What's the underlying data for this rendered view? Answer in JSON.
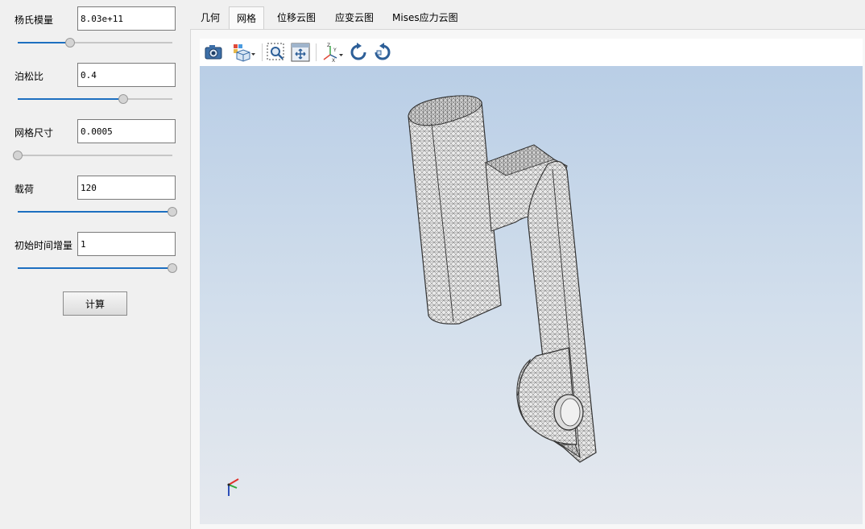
{
  "params": [
    {
      "label": "杨氏模量",
      "value": "8.03e+11",
      "slider": 0.34
    },
    {
      "label": "泊松比",
      "value": "0.4",
      "slider": 0.68
    },
    {
      "label": "网格尺寸",
      "value": "0.0005",
      "slider": 0.0
    },
    {
      "label": "载荷",
      "value": "120",
      "slider": 1.0
    },
    {
      "label": "初始时间增量",
      "value": "1",
      "slider": 1.0
    }
  ],
  "calc_button": "计算",
  "tabs": [
    "几何",
    "网格",
    "位移云图",
    "应变云图",
    "Mises应力云图"
  ],
  "active_tab": "网格",
  "toolbar_icons": [
    "camera-icon",
    "view-cube-icon",
    "zoom-box-icon",
    "fit-all-icon",
    "axes-triad-icon",
    "rotate-cw-icon",
    "rotate-ccw-icon"
  ],
  "colors": {
    "accent": "#1d6fc0",
    "viewport_top": "#b9cee6",
    "viewport_bottom": "#e6e9ee"
  }
}
